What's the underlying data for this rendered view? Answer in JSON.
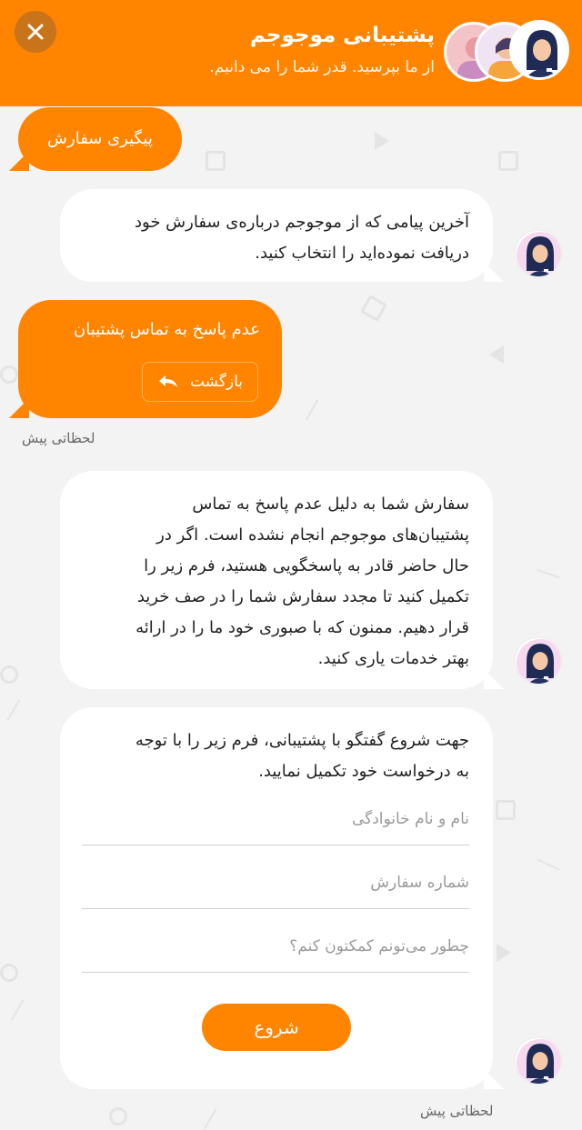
{
  "header": {
    "title": "پشتیبانی موجوجم",
    "subtitle": "از ما بپرسید. قدر شما را می دانیم.",
    "close_icon": "close-icon"
  },
  "colors": {
    "accent": "#ff8400",
    "background": "#f3f3f3",
    "bubble_bot": "#ffffff"
  },
  "messages": {
    "user_1": {
      "text": "پیگیری سفارش"
    },
    "bot_1": {
      "line1": "آخرین پیامی که از موجوجم درباره‌ی سفارش خود",
      "line2": "دریافت نموده‌اید را انتخاب کنید."
    },
    "user_2": {
      "text": "عدم پاسخ به تماس پشتیبان",
      "back_label": "بازگشت",
      "time": "لحظاتی پیش"
    },
    "bot_2": {
      "lines": [
        "سفارش شما به دلیل عدم پاسخ به تماس",
        "پشتیبان‌های موجوجم انجام نشده است. اگر در",
        "حال حاضر قادر به پاسخگویی هستید، فرم زیر را",
        "تکمیل کنید تا مجدد سفارش شما را در صف خرید",
        "قرار دهیم. ممنون که با صبوری خود ما را در ارائه",
        "بهتر خدمات یاری کنید."
      ]
    },
    "form": {
      "intro_line1": "جهت شروع گفتگو با پشتیبانی، فرم زیر را با توجه",
      "intro_line2": "به درخواست خود تکمیل نمایید.",
      "name_placeholder": "نام و نام خانوادگی",
      "order_placeholder": "شماره سفارش",
      "help_placeholder": "چطور می‌تونم کمکتون کنم؟",
      "start_label": "شروع",
      "time": "لحظاتی پیش"
    }
  }
}
